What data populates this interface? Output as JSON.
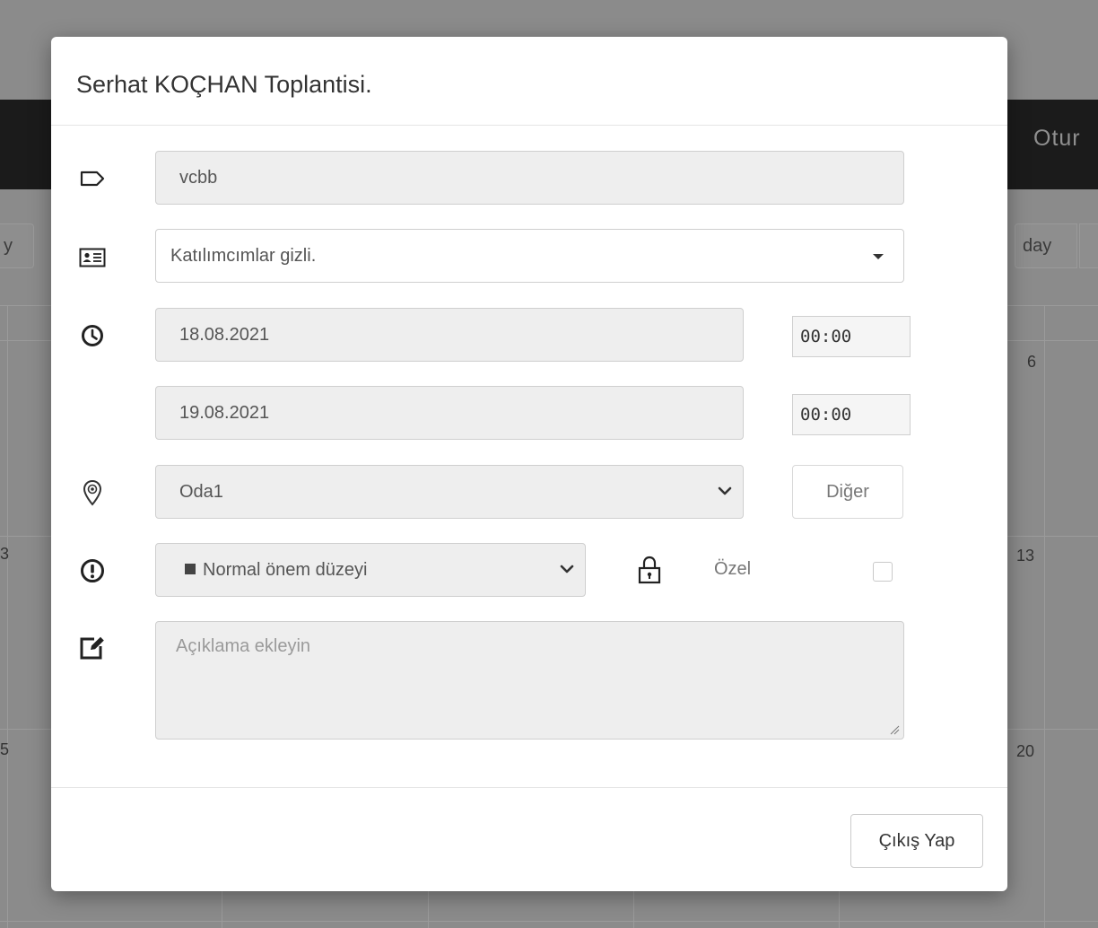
{
  "background": {
    "topbar_text": "Otur",
    "left_button": "y",
    "day_button": "day",
    "day_numbers": {
      "left_top": "3",
      "left_bottom": "5",
      "right_1": "6",
      "right_2": "13",
      "right_3": "20"
    }
  },
  "modal": {
    "title": "Serhat KOÇHAN Toplantisi.",
    "subject": {
      "value": "vcbb",
      "icon": "tag-icon"
    },
    "attendees": {
      "value": "Katılımcımlar gizli.",
      "icon": "contact-card-icon"
    },
    "start": {
      "date": "18.08.2021",
      "time": "00:00",
      "icon": "clock-icon"
    },
    "end": {
      "date": "19.08.2021",
      "time": "00:00"
    },
    "location": {
      "value": "Oda1",
      "other_label": "Diğer",
      "icon": "location-pin-icon"
    },
    "priority": {
      "value": "Normal önem düzeyi",
      "icon": "exclamation-circle-icon"
    },
    "private": {
      "label": "Özel",
      "checked": false,
      "icon": "lock-icon"
    },
    "description": {
      "placeholder": "Açıklama ekleyin",
      "value": "",
      "icon": "edit-note-icon"
    },
    "footer": {
      "exit_label": "Çıkış Yap"
    }
  }
}
